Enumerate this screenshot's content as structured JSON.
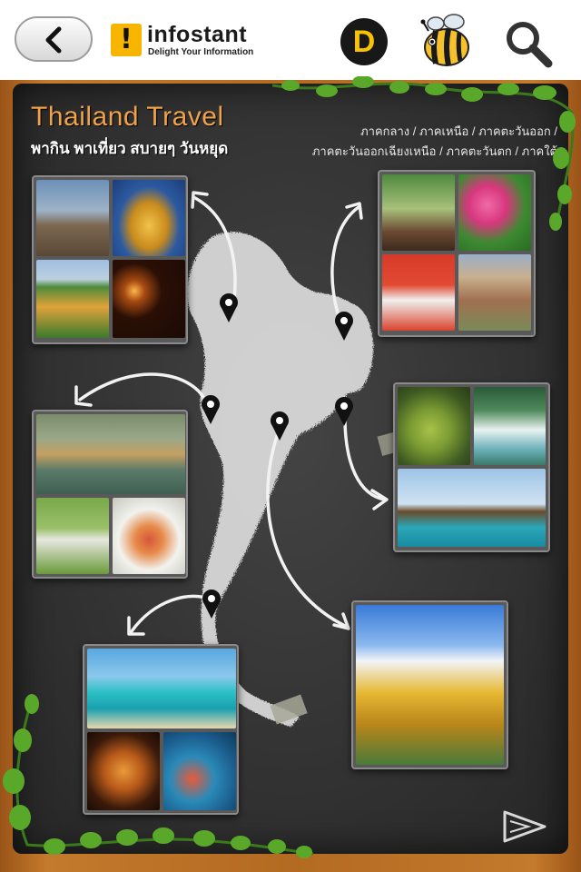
{
  "header": {
    "back_label": "",
    "logo_mark": "!",
    "logo_name": "infostant",
    "logo_tagline": "Delight Your Information",
    "d_badge": "D"
  },
  "content": {
    "title": "Thailand Travel",
    "subtitle": "พากิน พาเที่ยว สบายๆ วันหยุด",
    "regions_line1": "ภาคกลาง / ภาคเหนือ / ภาคตะวันออก /",
    "regions_line2": "ภาคตะวันออกเฉียงเหนือ / ภาคตะวันตก / ภาคใต้"
  },
  "colors": {
    "title_orange": "#f0a24a",
    "board": "#363636",
    "frame_wood": "#b36a22",
    "logo_yellow": "#f7b500"
  },
  "icons": [
    "back-arrow-icon",
    "logo-mark-icon",
    "d-badge-icon",
    "bee-icon",
    "search-icon",
    "map-pin-icon",
    "next-arrow-icon"
  ]
}
